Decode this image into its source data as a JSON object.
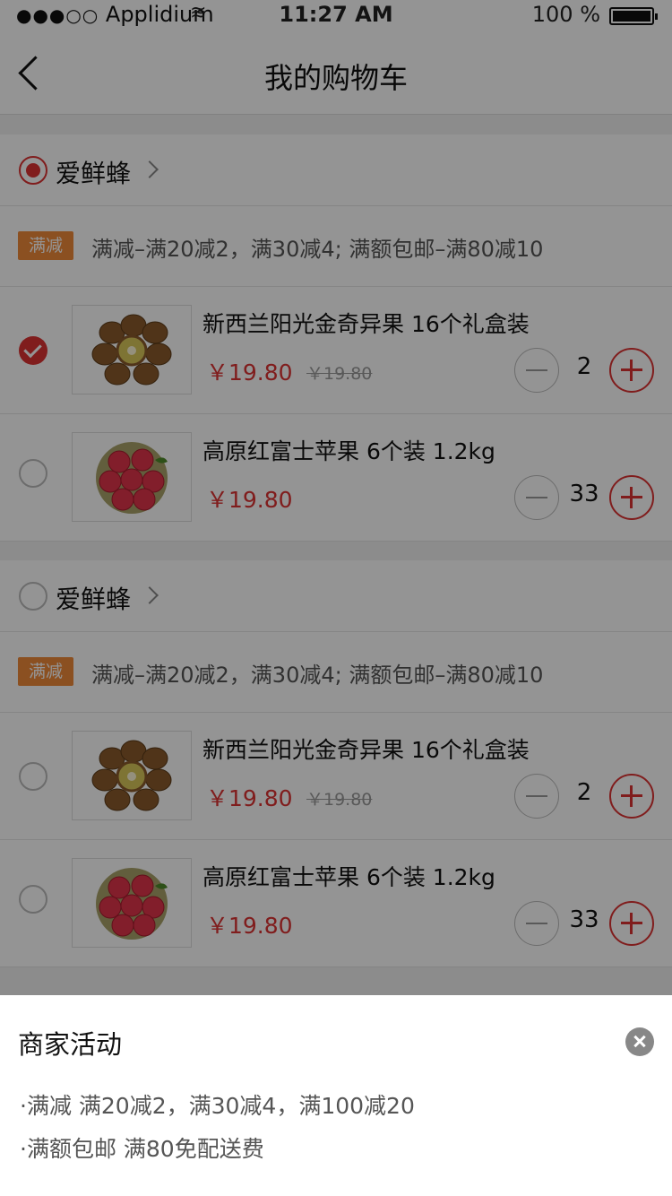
{
  "status_bar": {
    "carrier": "Applidium",
    "time": "11:27 AM",
    "battery": "100 %"
  },
  "nav": {
    "title": "我的购物车"
  },
  "shops": [
    {
      "name": "爱鲜蜂",
      "selected": true,
      "promo_badge": "满减",
      "promo_text": "满减–满20减2，满30减4; 满额包邮–满80减10",
      "items": [
        {
          "name": "新西兰阳光金奇异果 16个礼盒装",
          "price": "￥19.80",
          "original_price": "￥19.80",
          "quantity": "2",
          "selected": true,
          "image": "kiwi-icon"
        },
        {
          "name": "高原红富士苹果 6个装 1.2kg",
          "price": "￥19.80",
          "quantity": "33",
          "selected": false,
          "image": "apple-icon"
        }
      ]
    },
    {
      "name": "爱鲜蜂",
      "selected": false,
      "promo_badge": "满减",
      "promo_text": "满减–满20减2，满30减4; 满额包邮–满80减10",
      "items": [
        {
          "name": "新西兰阳光金奇异果 16个礼盒装",
          "price": "￥19.80",
          "original_price": "￥19.80",
          "quantity": "2",
          "selected": false,
          "image": "kiwi-icon"
        },
        {
          "name": "高原红富士苹果 6个装 1.2kg",
          "price": "￥19.80",
          "quantity": "33",
          "selected": false,
          "image": "apple-icon"
        }
      ]
    }
  ],
  "sheet": {
    "title": "商家活动",
    "lines": [
      "·满减 满20减2，满30减4，满100减20",
      "·满额包邮   满80免配送费"
    ]
  },
  "colors": {
    "accent": "#d33333",
    "promo_badge": "#f08a3a"
  }
}
